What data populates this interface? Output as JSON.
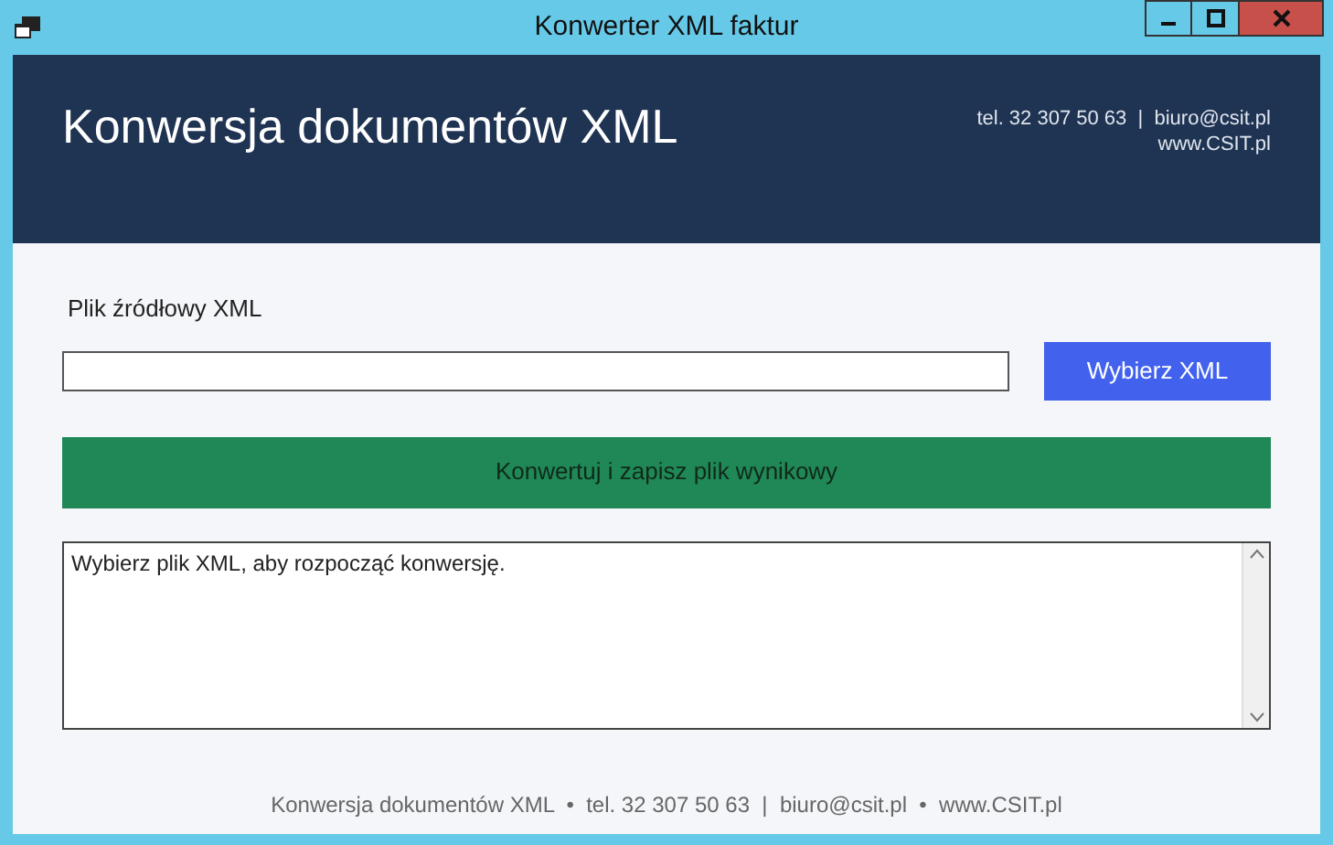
{
  "window": {
    "title": "Konwerter XML faktur"
  },
  "header": {
    "title": "Konwersja dokumentów XML",
    "contact_line": "tel. 32 307 50 63  |  biuro@csit.pl",
    "website": "www.CSIT.pl"
  },
  "source": {
    "label": "Plik źródłowy XML",
    "button": "Wybierz XML"
  },
  "convert_button": "Konwertuj i zapisz plik wynikowy",
  "log": {
    "text": "Wybierz plik XML, aby rozpocząć konwersję."
  },
  "footer": "Konwersja dokumentów XML  •  tel. 32 307 50 63  |  biuro@csit.pl  •  www.CSIT.pl"
}
